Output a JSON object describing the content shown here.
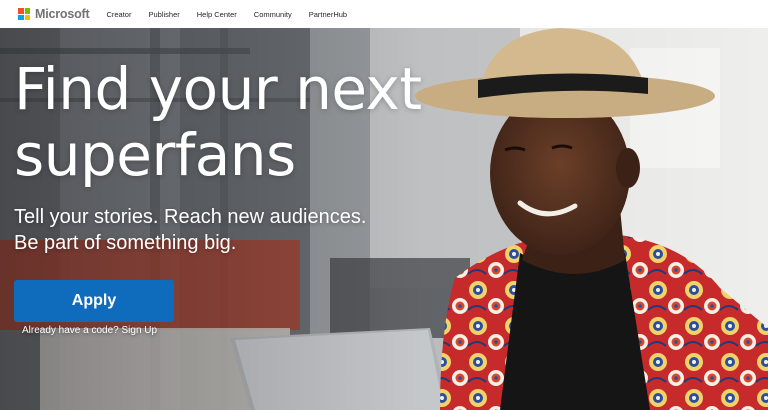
{
  "nav": {
    "logo_text": "Microsoft",
    "logo_colors": [
      "#f25022",
      "#7fba00",
      "#00a4ef",
      "#ffb900"
    ],
    "links": [
      "Creator",
      "Publisher",
      "Help Center",
      "Community",
      "PartnerHub"
    ]
  },
  "hero": {
    "headline_line1": "Find your next",
    "headline_line2": "superfans",
    "subline_line1": "Tell your stories. Reach new audiences.",
    "subline_line2": "Be part of something big.",
    "apply_label": "Apply",
    "signup_prefix": "Already have a code?",
    "signup_link": "Sign Up",
    "button_color": "#0f6cbd"
  }
}
